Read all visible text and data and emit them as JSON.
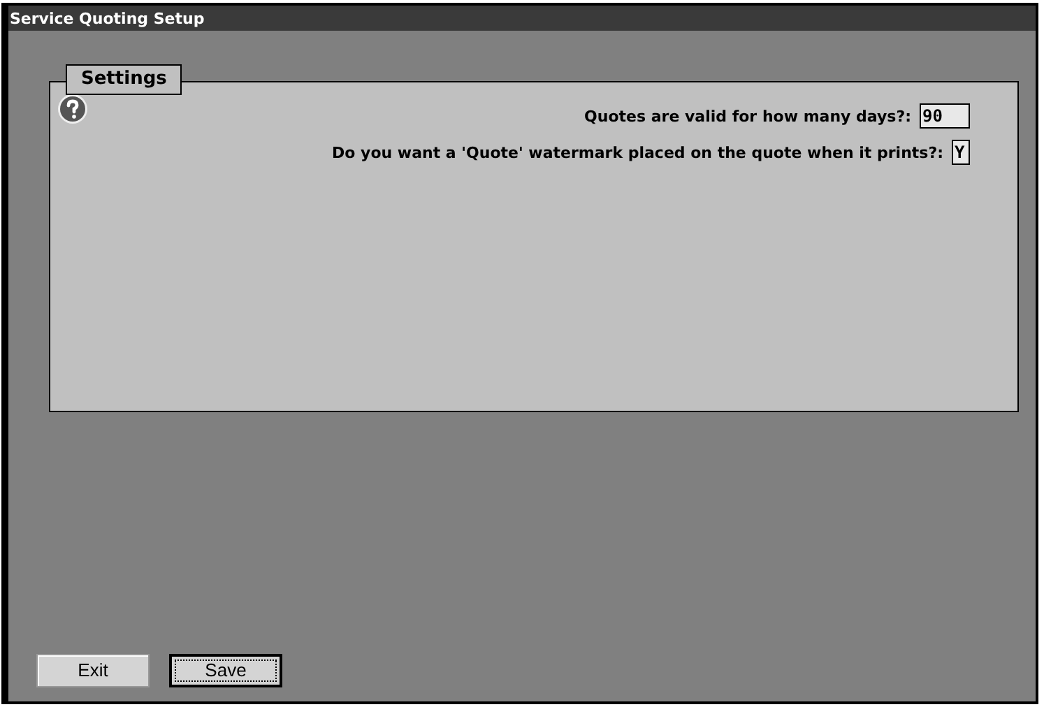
{
  "window": {
    "title": "Service Quoting Setup"
  },
  "settings": {
    "title": "Settings",
    "fields": [
      {
        "label": "Quotes are valid for how many days?:",
        "value": "90",
        "wide": true
      },
      {
        "label": "Do you want a 'Quote' watermark placed on the quote when it prints?:",
        "value": "Y",
        "wide": false
      }
    ]
  },
  "buttons": [
    {
      "label": "Exit",
      "focused": false
    },
    {
      "label": "Save",
      "focused": true
    }
  ]
}
